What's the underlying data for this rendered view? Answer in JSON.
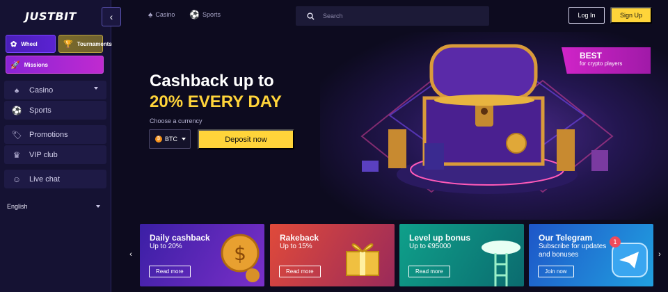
{
  "brand": {
    "logo": "JUSTBIT"
  },
  "sidebar": {
    "tiles": [
      {
        "label": "Wheel",
        "icon": "wheel-icon"
      },
      {
        "label": "Tournaments",
        "icon": "trophy-icon"
      },
      {
        "label": "Missions",
        "icon": "rocket-icon"
      }
    ],
    "items": [
      {
        "label": "Casino",
        "icon": "spade-icon"
      },
      {
        "label": "Sports",
        "icon": "soccer-ball-icon"
      },
      {
        "label": "Promotions",
        "icon": "tag-icon"
      },
      {
        "label": "VIP club",
        "icon": "crown-icon"
      },
      {
        "label": "Live chat",
        "icon": "person-icon"
      }
    ],
    "language": "English"
  },
  "topbar": {
    "casino_link": "Casino",
    "sports_link": "Sports",
    "search_placeholder": "Search",
    "login_label": "Log In",
    "signup_label": "Sign Up"
  },
  "hero": {
    "title_line1": "Cashback up to",
    "title_line2": "20% EVERY DAY",
    "currency_label": "Choose a currency",
    "currency_value": "BTC",
    "deposit_label": "Deposit now",
    "badge_title": "BEST",
    "badge_subtitle": "for crypto players"
  },
  "banners": [
    {
      "title": "Daily cashback",
      "subtitle": "Up to 20%",
      "button": "Read more"
    },
    {
      "title": "Rakeback",
      "subtitle": "Up to 15%",
      "button": "Read more"
    },
    {
      "title": "Level up bonus",
      "subtitle": "Up to €95000",
      "button": "Read more"
    },
    {
      "title": "Our Telegram",
      "subtitle": "Subscribe for updates and bonuses",
      "button": "Join now"
    }
  ],
  "colors": {
    "accent": "#ffd43a",
    "sidebar": "#151233",
    "page": "#0d0b1f"
  }
}
